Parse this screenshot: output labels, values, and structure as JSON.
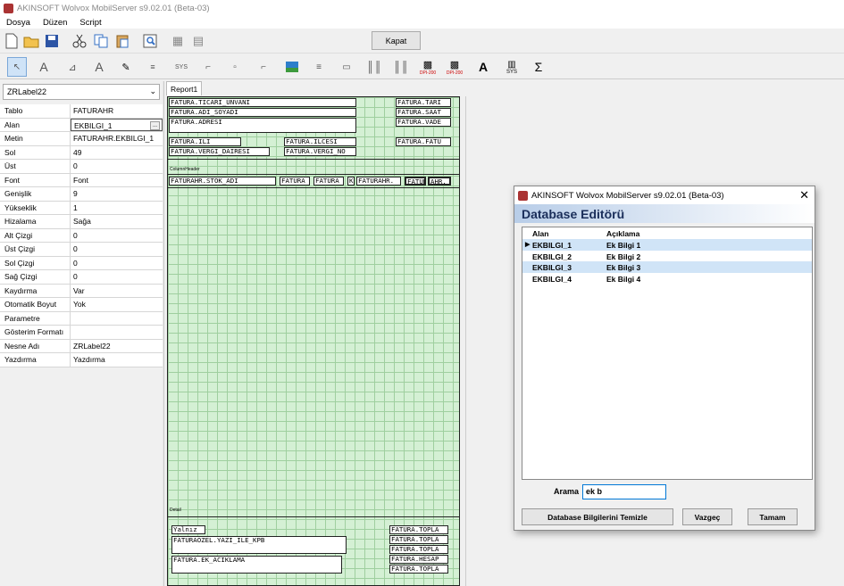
{
  "app": {
    "title": "AKINSOFT Wolvox MobilServer s9.02.01 (Beta-03)"
  },
  "menu": [
    "Dosya",
    "Düzen",
    "Script"
  ],
  "toolbar": {
    "close_label": "Kapat"
  },
  "icons": [
    "new-file-icon",
    "open-folder-icon",
    "save-icon",
    "cut-icon",
    "copy-icon",
    "paste-icon",
    "preview-icon",
    "grid-icon",
    "align-grid-icon"
  ],
  "toolbar2": {
    "labels": [
      "SYS",
      "DPI-200",
      "DPI-200",
      "SYS"
    ]
  },
  "left": {
    "component": "ZRLabel22",
    "props": [
      {
        "k": "Tablo",
        "v": "FATURAHR"
      },
      {
        "k": "Alan",
        "v": "EKBILGI_1"
      },
      {
        "k": "Metin",
        "v": "FATURAHR.EKBILGI_1"
      },
      {
        "k": "Sol",
        "v": "49"
      },
      {
        "k": "Üst",
        "v": "0"
      },
      {
        "k": "Font",
        "v": "Font"
      },
      {
        "k": "Genişlik",
        "v": "9"
      },
      {
        "k": "Yükseklik",
        "v": "1"
      },
      {
        "k": "Hizalama",
        "v": "Sağa"
      },
      {
        "k": "Alt Çizgi",
        "v": "0"
      },
      {
        "k": "Üst Çizgi",
        "v": "0"
      },
      {
        "k": "Sol Çizgi",
        "v": "0"
      },
      {
        "k": "Sağ Çizgi",
        "v": "0"
      },
      {
        "k": "Kaydırma",
        "v": "Var"
      },
      {
        "k": "Otomatik Boyut",
        "v": "Yok"
      },
      {
        "k": "Parametre",
        "v": ""
      },
      {
        "k": "Gösterim Formatı",
        "v": ""
      },
      {
        "k": "Nesne Adı",
        "v": "ZRLabel22"
      },
      {
        "k": "Yazdırma",
        "v": "Yazdırma"
      }
    ]
  },
  "report": {
    "tab": "Report1",
    "bands": {
      "column": "ColumnHeader",
      "detail": "Detail"
    },
    "fields": {
      "f1": "FATURA.TICARI_UNVANI",
      "f2": "FATURA.ADI_SOYADI",
      "f3": "FATURA.ADRESI",
      "f4": "FATURA.TARI",
      "f5": "FATURA.SAAT",
      "f6": "FATURA.VADE",
      "f7": "FATURA.ILI",
      "f8": "FATURA.ILCESI",
      "f9": "FATURA.FATU",
      "f10": "FATURA.VERGI_DAIRESI",
      "f11": "FATURA.VERGI_NO",
      "f12": "FATURAHR.STOK_ADI",
      "f13": "FATURA",
      "f14": "FATURA",
      "f15": "K",
      "f16": "FATURAHR.",
      "f17": "FATUR",
      "f18": "AHR.",
      "f19": "Yalnız",
      "f20": "FATURAOZEL.YAZI_ILE_KPB",
      "f21": "FATURA.EK_ACIKLAMA",
      "f22": "FATURA.TOPLA",
      "f23": "FATURA.TOPLA",
      "f24": "FATURA.TOPLA",
      "f25": "FATURA.HESAP",
      "f26": "FATURA.TOPLA"
    }
  },
  "dialog": {
    "title": "AKINSOFT Wolvox MobilServer s9.02.01 (Beta-03)",
    "heading": "Database Editörü",
    "columns": [
      "Alan",
      "Açıklama"
    ],
    "rows": [
      {
        "alan": "EKBILGI_1",
        "aciklama": "Ek Bilgi 1"
      },
      {
        "alan": "EKBILGI_2",
        "aciklama": "Ek Bilgi 2"
      },
      {
        "alan": "EKBILGI_3",
        "aciklama": "Ek Bilgi 3"
      },
      {
        "alan": "EKBILGI_4",
        "aciklama": "Ek Bilgi 4"
      }
    ],
    "search_label": "Arama",
    "search_value": "ek b",
    "buttons": {
      "clear": "Database Bilgilerini Temizle",
      "cancel": "Vazgeç",
      "ok": "Tamam"
    }
  }
}
